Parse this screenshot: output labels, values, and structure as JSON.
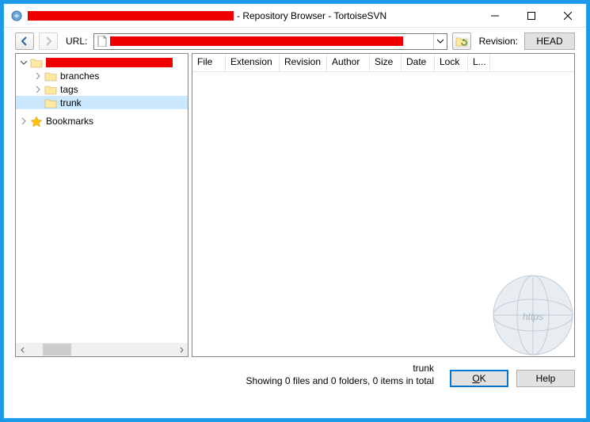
{
  "title_suffix": " - Repository Browser - TortoiseSVN",
  "toolbar": {
    "url_label": "URL:",
    "revision_label": "Revision:",
    "head_label": "HEAD"
  },
  "tree": {
    "items": [
      {
        "label": "branches"
      },
      {
        "label": "tags"
      },
      {
        "label": "trunk"
      }
    ],
    "bookmarks_label": "Bookmarks"
  },
  "list": {
    "columns": [
      "File",
      "Extension",
      "Revision",
      "Author",
      "Size",
      "Date",
      "Lock",
      "L..."
    ]
  },
  "status": {
    "path": "trunk",
    "summary": "Showing 0 files and 0 folders, 0 items in total"
  },
  "buttons": {
    "ok_prefix": "O",
    "ok_rest": "K",
    "help": "Help"
  },
  "watermark": "https"
}
